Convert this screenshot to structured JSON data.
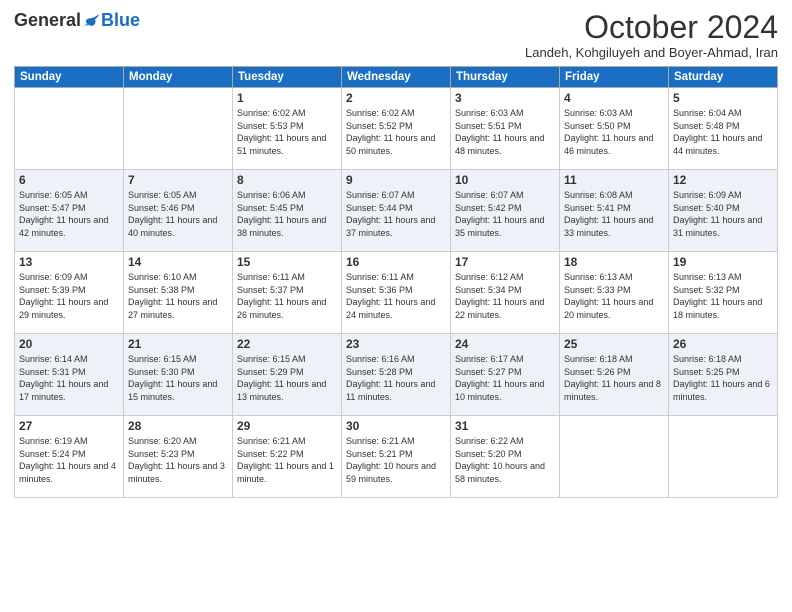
{
  "logo": {
    "general": "General",
    "blue": "Blue"
  },
  "header": {
    "month": "October 2024",
    "location": "Landeh, Kohgiluyeh and Boyer-Ahmad, Iran"
  },
  "days_of_week": [
    "Sunday",
    "Monday",
    "Tuesday",
    "Wednesday",
    "Thursday",
    "Friday",
    "Saturday"
  ],
  "weeks": [
    [
      {
        "day": "",
        "sunrise": "",
        "sunset": "",
        "daylight": ""
      },
      {
        "day": "",
        "sunrise": "",
        "sunset": "",
        "daylight": ""
      },
      {
        "day": "1",
        "sunrise": "Sunrise: 6:02 AM",
        "sunset": "Sunset: 5:53 PM",
        "daylight": "Daylight: 11 hours and 51 minutes."
      },
      {
        "day": "2",
        "sunrise": "Sunrise: 6:02 AM",
        "sunset": "Sunset: 5:52 PM",
        "daylight": "Daylight: 11 hours and 50 minutes."
      },
      {
        "day": "3",
        "sunrise": "Sunrise: 6:03 AM",
        "sunset": "Sunset: 5:51 PM",
        "daylight": "Daylight: 11 hours and 48 minutes."
      },
      {
        "day": "4",
        "sunrise": "Sunrise: 6:03 AM",
        "sunset": "Sunset: 5:50 PM",
        "daylight": "Daylight: 11 hours and 46 minutes."
      },
      {
        "day": "5",
        "sunrise": "Sunrise: 6:04 AM",
        "sunset": "Sunset: 5:48 PM",
        "daylight": "Daylight: 11 hours and 44 minutes."
      }
    ],
    [
      {
        "day": "6",
        "sunrise": "Sunrise: 6:05 AM",
        "sunset": "Sunset: 5:47 PM",
        "daylight": "Daylight: 11 hours and 42 minutes."
      },
      {
        "day": "7",
        "sunrise": "Sunrise: 6:05 AM",
        "sunset": "Sunset: 5:46 PM",
        "daylight": "Daylight: 11 hours and 40 minutes."
      },
      {
        "day": "8",
        "sunrise": "Sunrise: 6:06 AM",
        "sunset": "Sunset: 5:45 PM",
        "daylight": "Daylight: 11 hours and 38 minutes."
      },
      {
        "day": "9",
        "sunrise": "Sunrise: 6:07 AM",
        "sunset": "Sunset: 5:44 PM",
        "daylight": "Daylight: 11 hours and 37 minutes."
      },
      {
        "day": "10",
        "sunrise": "Sunrise: 6:07 AM",
        "sunset": "Sunset: 5:42 PM",
        "daylight": "Daylight: 11 hours and 35 minutes."
      },
      {
        "day": "11",
        "sunrise": "Sunrise: 6:08 AM",
        "sunset": "Sunset: 5:41 PM",
        "daylight": "Daylight: 11 hours and 33 minutes."
      },
      {
        "day": "12",
        "sunrise": "Sunrise: 6:09 AM",
        "sunset": "Sunset: 5:40 PM",
        "daylight": "Daylight: 11 hours and 31 minutes."
      }
    ],
    [
      {
        "day": "13",
        "sunrise": "Sunrise: 6:09 AM",
        "sunset": "Sunset: 5:39 PM",
        "daylight": "Daylight: 11 hours and 29 minutes."
      },
      {
        "day": "14",
        "sunrise": "Sunrise: 6:10 AM",
        "sunset": "Sunset: 5:38 PM",
        "daylight": "Daylight: 11 hours and 27 minutes."
      },
      {
        "day": "15",
        "sunrise": "Sunrise: 6:11 AM",
        "sunset": "Sunset: 5:37 PM",
        "daylight": "Daylight: 11 hours and 26 minutes."
      },
      {
        "day": "16",
        "sunrise": "Sunrise: 6:11 AM",
        "sunset": "Sunset: 5:36 PM",
        "daylight": "Daylight: 11 hours and 24 minutes."
      },
      {
        "day": "17",
        "sunrise": "Sunrise: 6:12 AM",
        "sunset": "Sunset: 5:34 PM",
        "daylight": "Daylight: 11 hours and 22 minutes."
      },
      {
        "day": "18",
        "sunrise": "Sunrise: 6:13 AM",
        "sunset": "Sunset: 5:33 PM",
        "daylight": "Daylight: 11 hours and 20 minutes."
      },
      {
        "day": "19",
        "sunrise": "Sunrise: 6:13 AM",
        "sunset": "Sunset: 5:32 PM",
        "daylight": "Daylight: 11 hours and 18 minutes."
      }
    ],
    [
      {
        "day": "20",
        "sunrise": "Sunrise: 6:14 AM",
        "sunset": "Sunset: 5:31 PM",
        "daylight": "Daylight: 11 hours and 17 minutes."
      },
      {
        "day": "21",
        "sunrise": "Sunrise: 6:15 AM",
        "sunset": "Sunset: 5:30 PM",
        "daylight": "Daylight: 11 hours and 15 minutes."
      },
      {
        "day": "22",
        "sunrise": "Sunrise: 6:15 AM",
        "sunset": "Sunset: 5:29 PM",
        "daylight": "Daylight: 11 hours and 13 minutes."
      },
      {
        "day": "23",
        "sunrise": "Sunrise: 6:16 AM",
        "sunset": "Sunset: 5:28 PM",
        "daylight": "Daylight: 11 hours and 11 minutes."
      },
      {
        "day": "24",
        "sunrise": "Sunrise: 6:17 AM",
        "sunset": "Sunset: 5:27 PM",
        "daylight": "Daylight: 11 hours and 10 minutes."
      },
      {
        "day": "25",
        "sunrise": "Sunrise: 6:18 AM",
        "sunset": "Sunset: 5:26 PM",
        "daylight": "Daylight: 11 hours and 8 minutes."
      },
      {
        "day": "26",
        "sunrise": "Sunrise: 6:18 AM",
        "sunset": "Sunset: 5:25 PM",
        "daylight": "Daylight: 11 hours and 6 minutes."
      }
    ],
    [
      {
        "day": "27",
        "sunrise": "Sunrise: 6:19 AM",
        "sunset": "Sunset: 5:24 PM",
        "daylight": "Daylight: 11 hours and 4 minutes."
      },
      {
        "day": "28",
        "sunrise": "Sunrise: 6:20 AM",
        "sunset": "Sunset: 5:23 PM",
        "daylight": "Daylight: 11 hours and 3 minutes."
      },
      {
        "day": "29",
        "sunrise": "Sunrise: 6:21 AM",
        "sunset": "Sunset: 5:22 PM",
        "daylight": "Daylight: 11 hours and 1 minute."
      },
      {
        "day": "30",
        "sunrise": "Sunrise: 6:21 AM",
        "sunset": "Sunset: 5:21 PM",
        "daylight": "Daylight: 10 hours and 59 minutes."
      },
      {
        "day": "31",
        "sunrise": "Sunrise: 6:22 AM",
        "sunset": "Sunset: 5:20 PM",
        "daylight": "Daylight: 10 hours and 58 minutes."
      },
      {
        "day": "",
        "sunrise": "",
        "sunset": "",
        "daylight": ""
      },
      {
        "day": "",
        "sunrise": "",
        "sunset": "",
        "daylight": ""
      }
    ]
  ]
}
